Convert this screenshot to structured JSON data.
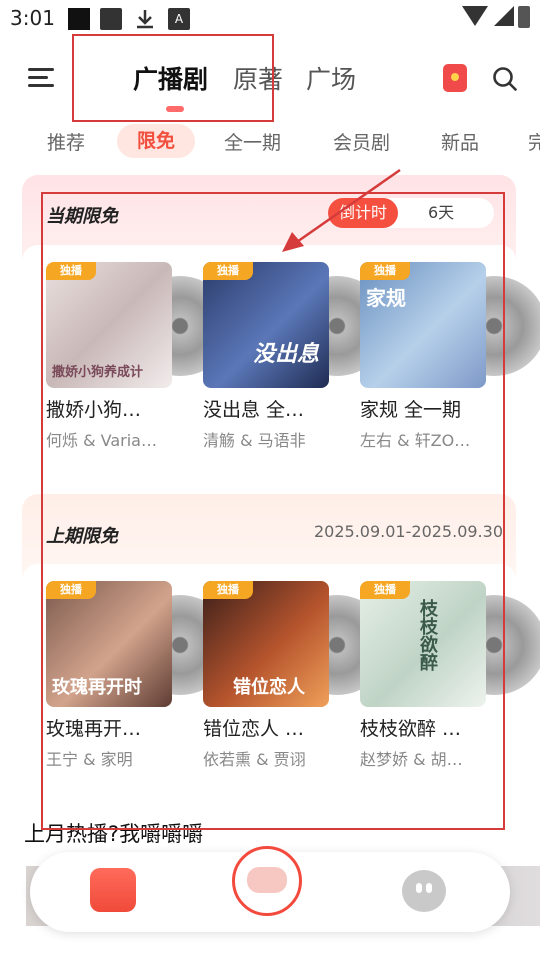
{
  "status_bar": {
    "time": "3:01",
    "notif_badge": "A"
  },
  "header": {
    "tabs": [
      {
        "label": "广播剧",
        "active": true
      },
      {
        "label": "原著",
        "active": false
      },
      {
        "label": "广场",
        "active": false
      }
    ],
    "icons": [
      "menu-icon",
      "red-packet-icon",
      "search-icon"
    ]
  },
  "subtabs": [
    {
      "label": "推荐",
      "active": false
    },
    {
      "label": "限免",
      "active": true
    },
    {
      "label": "全一期",
      "active": false
    },
    {
      "label": "会员剧",
      "active": false
    },
    {
      "label": "新品",
      "active": false
    },
    {
      "label": "完",
      "active": false
    }
  ],
  "current_free": {
    "title": "当期限免",
    "countdown_label": "倒计时",
    "countdown_value": "6天",
    "items": [
      {
        "badge": "独播",
        "cover_text": "撒娇小狗养成计",
        "title": "撒娇小狗…",
        "cast": "何烁 & Varia…"
      },
      {
        "badge": "独播",
        "cover_text": "没出息",
        "title": "没出息 全…",
        "cast": "清觞 & 马语非"
      },
      {
        "badge": "独播",
        "cover_text": "家规",
        "title": "家规 全一期",
        "cast": "左右 & 轩ZO…"
      }
    ]
  },
  "previous_free": {
    "title": "上期限免",
    "date_range": "2025.09.01-2025.09.30",
    "items": [
      {
        "badge": "独播",
        "cover_text": "玫瑰再开时",
        "title": "玫瑰再开…",
        "cast": "王宁 & 家明"
      },
      {
        "badge": "独播",
        "cover_text": "错位恋人",
        "title": "错位恋人 …",
        "cast": "依若熏 & 贾诩"
      },
      {
        "badge": "独播",
        "cover_text": "枝枝欲醉",
        "title": "枝枝欲醉 …",
        "cast": "赵梦娇 & 胡…"
      }
    ]
  },
  "hot_section": {
    "title": "上月热播?我嚼嚼嚼"
  },
  "bottom_nav": {
    "items": [
      "shop-bag-icon",
      "mascot-icon",
      "profile-face-icon"
    ]
  },
  "colors": {
    "accent": "#f5503f",
    "badge": "#f5a623",
    "annotation": "#d63b3b"
  }
}
